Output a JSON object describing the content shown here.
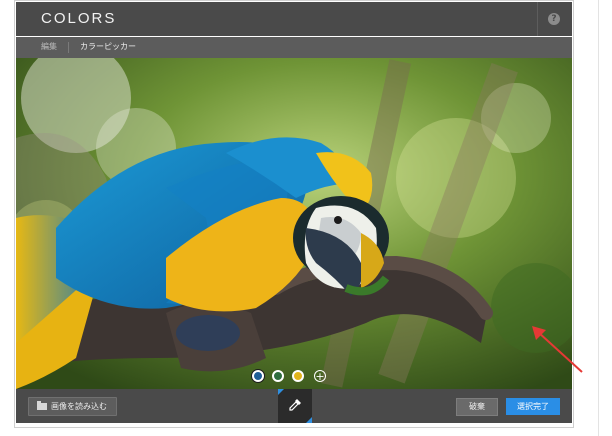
{
  "app": {
    "title": "COLORS",
    "help_glyph": "?"
  },
  "tabs": [
    {
      "label": "編集",
      "active": false
    },
    {
      "label": "カラーピッカー",
      "active": true
    }
  ],
  "photo": {
    "subject": "parrot-photo"
  },
  "swatches": [
    {
      "color": "#1f5e97",
      "selected": true
    },
    {
      "color": "#2f6d3f",
      "selected": false
    },
    {
      "color": "#e1b41c",
      "selected": false
    }
  ],
  "add_swatch_glyph": "+",
  "toolbar": {
    "load_label": "画像を読み込む",
    "discard_label": "破棄",
    "select_label": "選択完了",
    "active_tool_icon": "eyedropper-icon"
  },
  "annotation": {
    "arrow_color": "#e53935"
  }
}
